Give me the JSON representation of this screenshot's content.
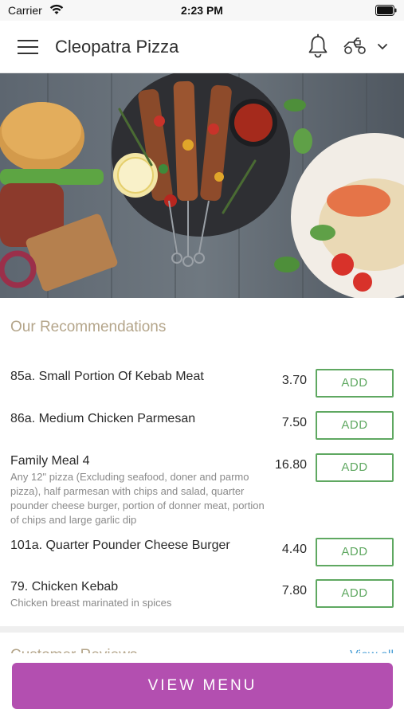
{
  "status_bar": {
    "carrier": "Carrier",
    "time": "2:23 PM"
  },
  "header": {
    "title": "Cleopatra Pizza",
    "icons": [
      "hamburger-menu-icon",
      "bell-icon",
      "scooter-icon",
      "chevron-down-icon"
    ]
  },
  "recommendations": {
    "title": "Our Recommendations",
    "items": [
      {
        "name": "85a. Small Portion Of Kebab Meat",
        "description": "",
        "price": "3.70",
        "button": "ADD"
      },
      {
        "name": "86a. Medium Chicken Parmesan",
        "description": "",
        "price": "7.50",
        "button": "ADD"
      },
      {
        "name": "Family Meal 4",
        "description": "Any 12\" pizza (Excluding seafood, doner and parmo pizza), half parmesan with chips and salad, quarter pounder cheese burger, portion of donner meat, portion of chips and large garlic dip",
        "price": "16.80",
        "button": "ADD"
      },
      {
        "name": "101a. Quarter Pounder Cheese Burger",
        "description": "",
        "price": "4.40",
        "button": "ADD"
      },
      {
        "name": "79. Chicken Kebab",
        "description": "Chicken breast marinated in spices",
        "price": "7.80",
        "button": "ADD"
      }
    ]
  },
  "reviews": {
    "title": "Customer Reviews",
    "view_all": "View all"
  },
  "footer": {
    "view_menu": "VIEW MENU"
  },
  "colors": {
    "accent_add": "#5fa861",
    "view_menu": "#b34fb0",
    "section_title": "#b4a58a"
  }
}
